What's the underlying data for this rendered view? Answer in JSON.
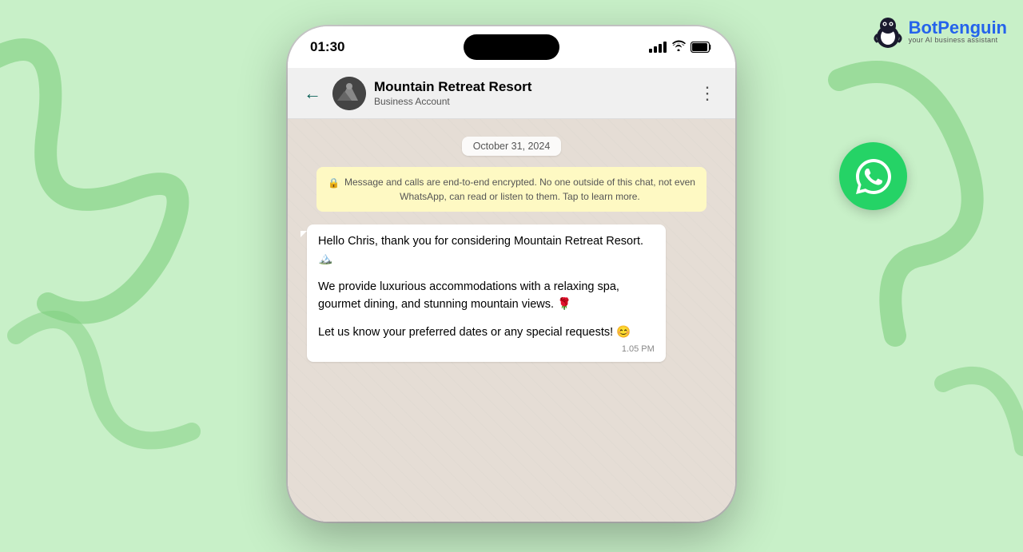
{
  "background": {
    "color": "#c8f0c8"
  },
  "botpenguin": {
    "name_part1": "Bot",
    "name_part2": "Penguin",
    "tagline": "your AI business assistant"
  },
  "status_bar": {
    "time": "01:30"
  },
  "chat_header": {
    "contact_name": "Mountain Retreat Resort",
    "contact_status": "Business Account",
    "back_label": "←"
  },
  "date_badge": {
    "label": "October 31, 2024"
  },
  "encryption_notice": {
    "text": "Message and calls are end-to-end encrypted. No one outside of this chat, not even WhatsApp, can read or listen to them. Tap to learn more."
  },
  "message": {
    "paragraph1": "Hello Chris, thank you for considering Mountain Retreat Resort. 🏔️",
    "paragraph2": "We provide luxurious accommodations with a relaxing spa, gourmet dining, and stunning mountain views. 🌹",
    "paragraph3": "Let us know your preferred dates or any special requests! 😊",
    "time": "1.05 PM"
  }
}
